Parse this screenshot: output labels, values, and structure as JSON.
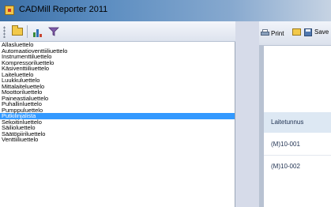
{
  "window": {
    "title": "CADMill Reporter 2011"
  },
  "left_toolbar": {
    "buttons": [
      {
        "icon": "folder-open-icon"
      },
      {
        "icon": "chart-icon"
      },
      {
        "icon": "filter-icon"
      }
    ]
  },
  "report_list": {
    "items": [
      "Allasluettelo",
      "Automaatioventtiiliuettelo",
      "Instrumenttiluettelo",
      "Kompressoriluettelo",
      "Käsiventtiiliuettelo",
      "Laiteluettelo",
      "Luukkuluettelo",
      "Mittalaiteluettelo",
      "Moottoriluettelo",
      "Paineastialuettelo",
      "Puhallinluettelo",
      "Pumppuluettelo",
      "Putkilinjalista",
      "Sekoitinluettelo",
      "Säilioluettelo",
      "Säätöpiiriluettelo",
      "Venttiiliuettelo"
    ],
    "selected_index": 12
  },
  "report_toolbar": {
    "print_label": "Print",
    "save_label": "Save"
  },
  "report_preview": {
    "column_header": "Laitetunnus",
    "rows": [
      "(M)10-001",
      "(M)10-002"
    ]
  },
  "colors": {
    "selection": "#3399ff",
    "header_band": "#dde8f3"
  }
}
